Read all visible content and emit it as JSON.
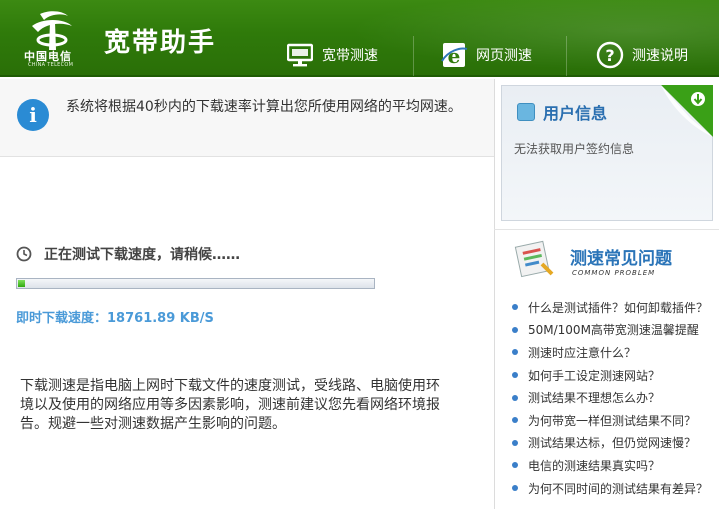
{
  "header": {
    "logo_cn": "中国电信",
    "logo_en": "CHINA TELECOM",
    "app_title": "宽带助手",
    "nav": [
      {
        "label": "宽带测速",
        "icon": "monitor-icon"
      },
      {
        "label": "网页测速",
        "icon": "browser-e-icon"
      },
      {
        "label": "测速说明",
        "icon": "question-icon"
      }
    ]
  },
  "info_bar": {
    "text": "系统将根据40秒内的下载速率计算出您所使用网络的平均网速。"
  },
  "test": {
    "status": "正在测试下载速度，请稍候……",
    "progress": 0.02,
    "speed_label": "即时下载速度：",
    "speed_value": "18761.89 KB/S",
    "description": "下载测速是指电脑上网时下载文件的速度测试，受线路、电脑使用环境以及使用的网络应用等多因素影响，测速前建议您先看网络环境报告。规避一些对测速数据产生影响的问题。"
  },
  "user_info": {
    "title": "用户信息",
    "message": "无法获取用户签约信息"
  },
  "faq": {
    "title": "测速常见问题",
    "subtitle": "COMMON PROBLEM",
    "items": [
      "什么是测试插件？如何卸载插件？",
      "50M/100M高带宽测速温馨提醒",
      "测速时应注意什么？",
      "如何手工设定测速网站？",
      "测试结果不理想怎么办？",
      "为何带宽一样但测试结果不同？",
      "测试结果达标，但仍觉网速慢？",
      "电信的测速结果真实吗？",
      "为何不同时间的测试结果有差异？"
    ]
  },
  "colors": {
    "header_green": "#2f7a0a",
    "accent_blue": "#2a74b8",
    "progress_green": "#2fa80e"
  }
}
